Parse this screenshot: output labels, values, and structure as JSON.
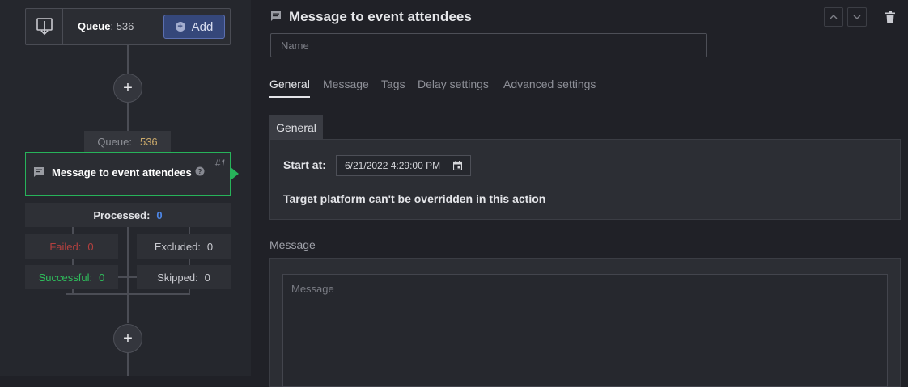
{
  "flow": {
    "queue_node": {
      "label": "Queue",
      "count": ": 536",
      "add_label": "Add"
    },
    "queue_tag": {
      "label": "Queue:",
      "value": "536"
    },
    "action": {
      "title": "Message to event attendees",
      "number": "#1"
    },
    "stats": {
      "processed": {
        "label": "Processed:",
        "value": "0"
      },
      "failed": {
        "label": "Failed:",
        "value": "0"
      },
      "excluded": {
        "label": "Excluded:",
        "value": "0"
      },
      "successful": {
        "label": "Successful:",
        "value": "0"
      },
      "skipped": {
        "label": "Skipped:",
        "value": "0"
      }
    }
  },
  "header": {
    "title": "Message to event attendees"
  },
  "name_field": {
    "placeholder": "Name",
    "value": ""
  },
  "tabs": [
    "General",
    "Message",
    "Tags",
    "Delay settings",
    "Advanced settings"
  ],
  "general": {
    "section_label": "General",
    "start_label": "Start at:",
    "start_value": "6/21/2022 4:29:00 PM",
    "note": "Target platform can't be overridden in this action"
  },
  "message": {
    "heading": "Message",
    "placeholder": "Message",
    "value": ""
  },
  "colors": {
    "accent_green": "#27b35a",
    "add_button": "#35477a",
    "failed": "#b3403f",
    "processed": "#4d86e6"
  }
}
